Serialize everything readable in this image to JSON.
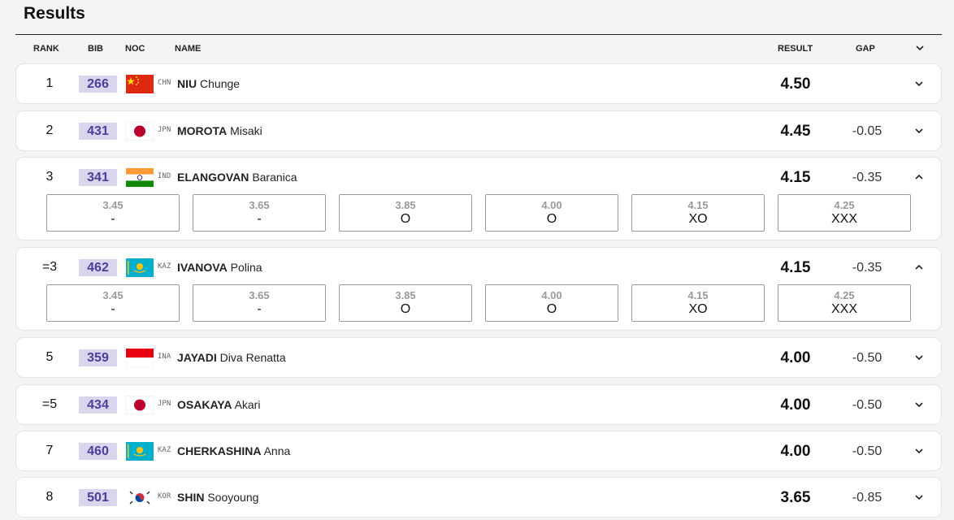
{
  "page": {
    "title": "Results"
  },
  "columns": {
    "rank": "RANK",
    "bib": "BIB",
    "noc": "NOC",
    "name": "NAME",
    "result": "RESULT",
    "gap": "GAP"
  },
  "rows": [
    {
      "rank": "1",
      "bib": "266",
      "noc": "CHN",
      "last": "NIU",
      "first": "Chunge",
      "result": "4.50",
      "gap": "",
      "expanded": false,
      "flag": "chn"
    },
    {
      "rank": "2",
      "bib": "431",
      "noc": "JPN",
      "last": "MOROTA",
      "first": "Misaki",
      "result": "4.45",
      "gap": "-0.05",
      "expanded": false,
      "flag": "jpn"
    },
    {
      "rank": "3",
      "bib": "341",
      "noc": "IND",
      "last": "ELANGOVAN",
      "first": "Baranica",
      "result": "4.15",
      "gap": "-0.35",
      "expanded": true,
      "flag": "ind",
      "attempts": [
        {
          "height": "3.45",
          "mark": "-"
        },
        {
          "height": "3.65",
          "mark": "-"
        },
        {
          "height": "3.85",
          "mark": "O"
        },
        {
          "height": "4.00",
          "mark": "O"
        },
        {
          "height": "4.15",
          "mark": "XO"
        },
        {
          "height": "4.25",
          "mark": "XXX"
        }
      ]
    },
    {
      "rank": "=3",
      "bib": "462",
      "noc": "KAZ",
      "last": "IVANOVA",
      "first": "Polina",
      "result": "4.15",
      "gap": "-0.35",
      "expanded": true,
      "flag": "kaz",
      "attempts": [
        {
          "height": "3.45",
          "mark": "-"
        },
        {
          "height": "3.65",
          "mark": "-"
        },
        {
          "height": "3.85",
          "mark": "O"
        },
        {
          "height": "4.00",
          "mark": "O"
        },
        {
          "height": "4.15",
          "mark": "XO"
        },
        {
          "height": "4.25",
          "mark": "XXX"
        }
      ]
    },
    {
      "rank": "5",
      "bib": "359",
      "noc": "INA",
      "last": "JAYADI",
      "first": "Diva Renatta",
      "result": "4.00",
      "gap": "-0.50",
      "expanded": false,
      "flag": "ina"
    },
    {
      "rank": "=5",
      "bib": "434",
      "noc": "JPN",
      "last": "OSAKAYA",
      "first": "Akari",
      "result": "4.00",
      "gap": "-0.50",
      "expanded": false,
      "flag": "jpn"
    },
    {
      "rank": "7",
      "bib": "460",
      "noc": "KAZ",
      "last": "CHERKASHINA",
      "first": "Anna",
      "result": "4.00",
      "gap": "-0.50",
      "expanded": false,
      "flag": "kaz"
    },
    {
      "rank": "8",
      "bib": "501",
      "noc": "KOR",
      "last": "SHIN",
      "first": "Sooyoung",
      "result": "3.65",
      "gap": "-0.85",
      "expanded": false,
      "flag": "kor"
    }
  ],
  "colors": {
    "bib_bg": "#d9d5ec",
    "bib_text": "#4a3f9a",
    "attempt_height": "#999999"
  },
  "icons": {
    "expand": "chevron-down-icon",
    "collapse": "chevron-up-icon"
  }
}
